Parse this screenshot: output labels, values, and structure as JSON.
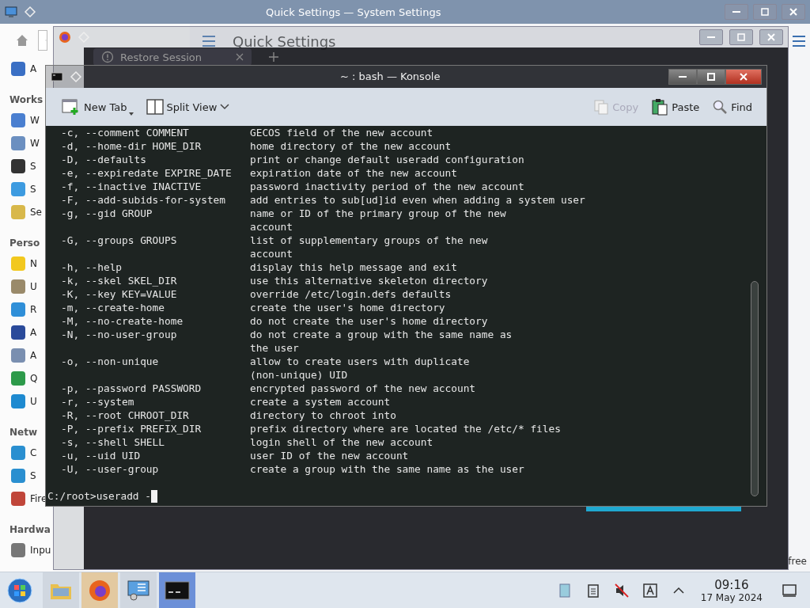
{
  "settings_window": {
    "title": "Quick Settings — System Settings",
    "heading": "Quick Settings",
    "sidebar": [
      {
        "kind": "item",
        "label": "A",
        "color": "#3a6fc4"
      },
      {
        "kind": "header",
        "label": "Works"
      },
      {
        "kind": "item",
        "label": "W",
        "color": "#4a7fd0"
      },
      {
        "kind": "item",
        "label": "W",
        "color": "#6b8fc0"
      },
      {
        "kind": "item",
        "label": "S",
        "color": "#333333"
      },
      {
        "kind": "item",
        "label": "S",
        "color": "#3d9be0"
      },
      {
        "kind": "item",
        "label": "Se",
        "color": "#d8b84a"
      },
      {
        "kind": "header",
        "label": "Perso"
      },
      {
        "kind": "item",
        "label": "N",
        "color": "#f2c81e"
      },
      {
        "kind": "item",
        "label": "U",
        "color": "#9a8a6a"
      },
      {
        "kind": "item",
        "label": "R",
        "color": "#2f8fd8"
      },
      {
        "kind": "item",
        "label": "A",
        "color": "#2a4a9a"
      },
      {
        "kind": "item",
        "label": "A",
        "color": "#7a8fb0"
      },
      {
        "kind": "item",
        "label": "Q",
        "color": "#2d9a4a"
      },
      {
        "kind": "item",
        "label": "U",
        "color": "#1e8ad0"
      },
      {
        "kind": "header",
        "label": "Netw"
      },
      {
        "kind": "item",
        "label": "C",
        "color": "#2a8fd0"
      },
      {
        "kind": "item",
        "label": "S",
        "color": "#2a8fd0"
      },
      {
        "kind": "item",
        "label": "Fire",
        "color": "#c0463a"
      },
      {
        "kind": "header",
        "label": "Hardwa"
      },
      {
        "kind": "item",
        "label": "Inpu",
        "color": "#777777"
      }
    ],
    "footer_text": "free"
  },
  "browser_window": {
    "tabs": [
      {
        "label": "Restore Session",
        "selected": true
      }
    ]
  },
  "konsole": {
    "title": "~ : bash — Konsole",
    "toolbar": [
      {
        "kind": "new-tab",
        "label": "New Tab",
        "disabled": false
      },
      {
        "kind": "split-view",
        "label": "Split View",
        "disabled": false
      },
      {
        "kind": "copy",
        "label": "Copy",
        "disabled": true
      },
      {
        "kind": "paste",
        "label": "Paste",
        "disabled": false
      },
      {
        "kind": "find",
        "label": "Find",
        "disabled": false
      }
    ],
    "lines": [
      {
        "option": "-c, --comment COMMENT",
        "description": [
          "GECOS field of the new account"
        ]
      },
      {
        "option": "-d, --home-dir HOME_DIR",
        "description": [
          "home directory of the new account"
        ]
      },
      {
        "option": "-D, --defaults",
        "description": [
          "print or change default useradd configuration"
        ]
      },
      {
        "option": "-e, --expiredate EXPIRE_DATE",
        "description": [
          "expiration date of the new account"
        ]
      },
      {
        "option": "-f, --inactive INACTIVE",
        "description": [
          "password inactivity period of the new account"
        ]
      },
      {
        "option": "-F, --add-subids-for-system",
        "description": [
          "add entries to sub[ud]id even when adding a system user"
        ]
      },
      {
        "option": "-g, --gid GROUP",
        "description": [
          "name or ID of the primary group of the new",
          "account"
        ]
      },
      {
        "option": "-G, --groups GROUPS",
        "description": [
          "list of supplementary groups of the new",
          "account"
        ]
      },
      {
        "option": "-h, --help",
        "description": [
          "display this help message and exit"
        ]
      },
      {
        "option": "-k, --skel SKEL_DIR",
        "description": [
          "use this alternative skeleton directory"
        ]
      },
      {
        "option": "-K, --key KEY=VALUE",
        "description": [
          "override /etc/login.defs defaults"
        ]
      },
      {
        "option": "-m, --create-home",
        "description": [
          "create the user's home directory"
        ]
      },
      {
        "option": "-M, --no-create-home",
        "description": [
          "do not create the user's home directory"
        ]
      },
      {
        "option": "-N, --no-user-group",
        "description": [
          "do not create a group with the same name as",
          "the user"
        ]
      },
      {
        "option": "-o, --non-unique",
        "description": [
          "allow to create users with duplicate",
          "(non-unique) UID"
        ]
      },
      {
        "option": "-p, --password PASSWORD",
        "description": [
          "encrypted password of the new account"
        ]
      },
      {
        "option": "-r, --system",
        "description": [
          "create a system account"
        ]
      },
      {
        "option": "-R, --root CHROOT_DIR",
        "description": [
          "directory to chroot into"
        ]
      },
      {
        "option": "-P, --prefix PREFIX_DIR",
        "description": [
          "prefix directory where are located the /etc/* files"
        ]
      },
      {
        "option": "-s, --shell SHELL",
        "description": [
          "login shell of the new account"
        ]
      },
      {
        "option": "-u, --uid UID",
        "description": [
          "user ID of the new account"
        ]
      },
      {
        "option": "-U, --user-group",
        "description": [
          "create a group with the same name as the user"
        ]
      }
    ],
    "prompt": "C:/root>useradd -"
  },
  "taskbar": {
    "apps": [
      {
        "kind": "files",
        "selected": false,
        "attention": false
      },
      {
        "kind": "firefox",
        "selected": false,
        "attention": true
      },
      {
        "kind": "settings",
        "selected": false,
        "attention": false
      },
      {
        "kind": "terminal",
        "selected": true,
        "attention": false
      }
    ],
    "clock": {
      "time": "09:16",
      "date": "17 May 2024"
    }
  }
}
